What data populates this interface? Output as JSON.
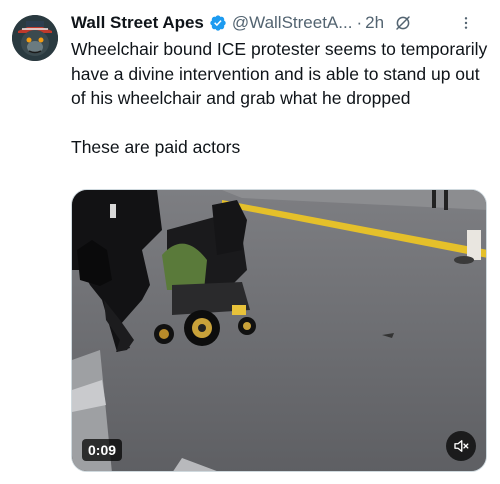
{
  "tweet": {
    "author": {
      "display_name": "Wall Street Apes",
      "handle": "@WallStreetA...",
      "avatar_icon": "gorilla-avatar",
      "verified": true
    },
    "separator": "·",
    "time": "2h",
    "text_line_1": "Wheelchair bound ICE protester seems to temporarily have a divine intervention and is able to stand up out of his wheelchair and grab what he dropped",
    "text_line_2": "These are paid actors",
    "media": {
      "type": "video",
      "duration": "0:09",
      "muted": true
    }
  },
  "colors": {
    "text": "#0f1419",
    "secondary": "#536471",
    "verified": "#1d9bf0"
  }
}
